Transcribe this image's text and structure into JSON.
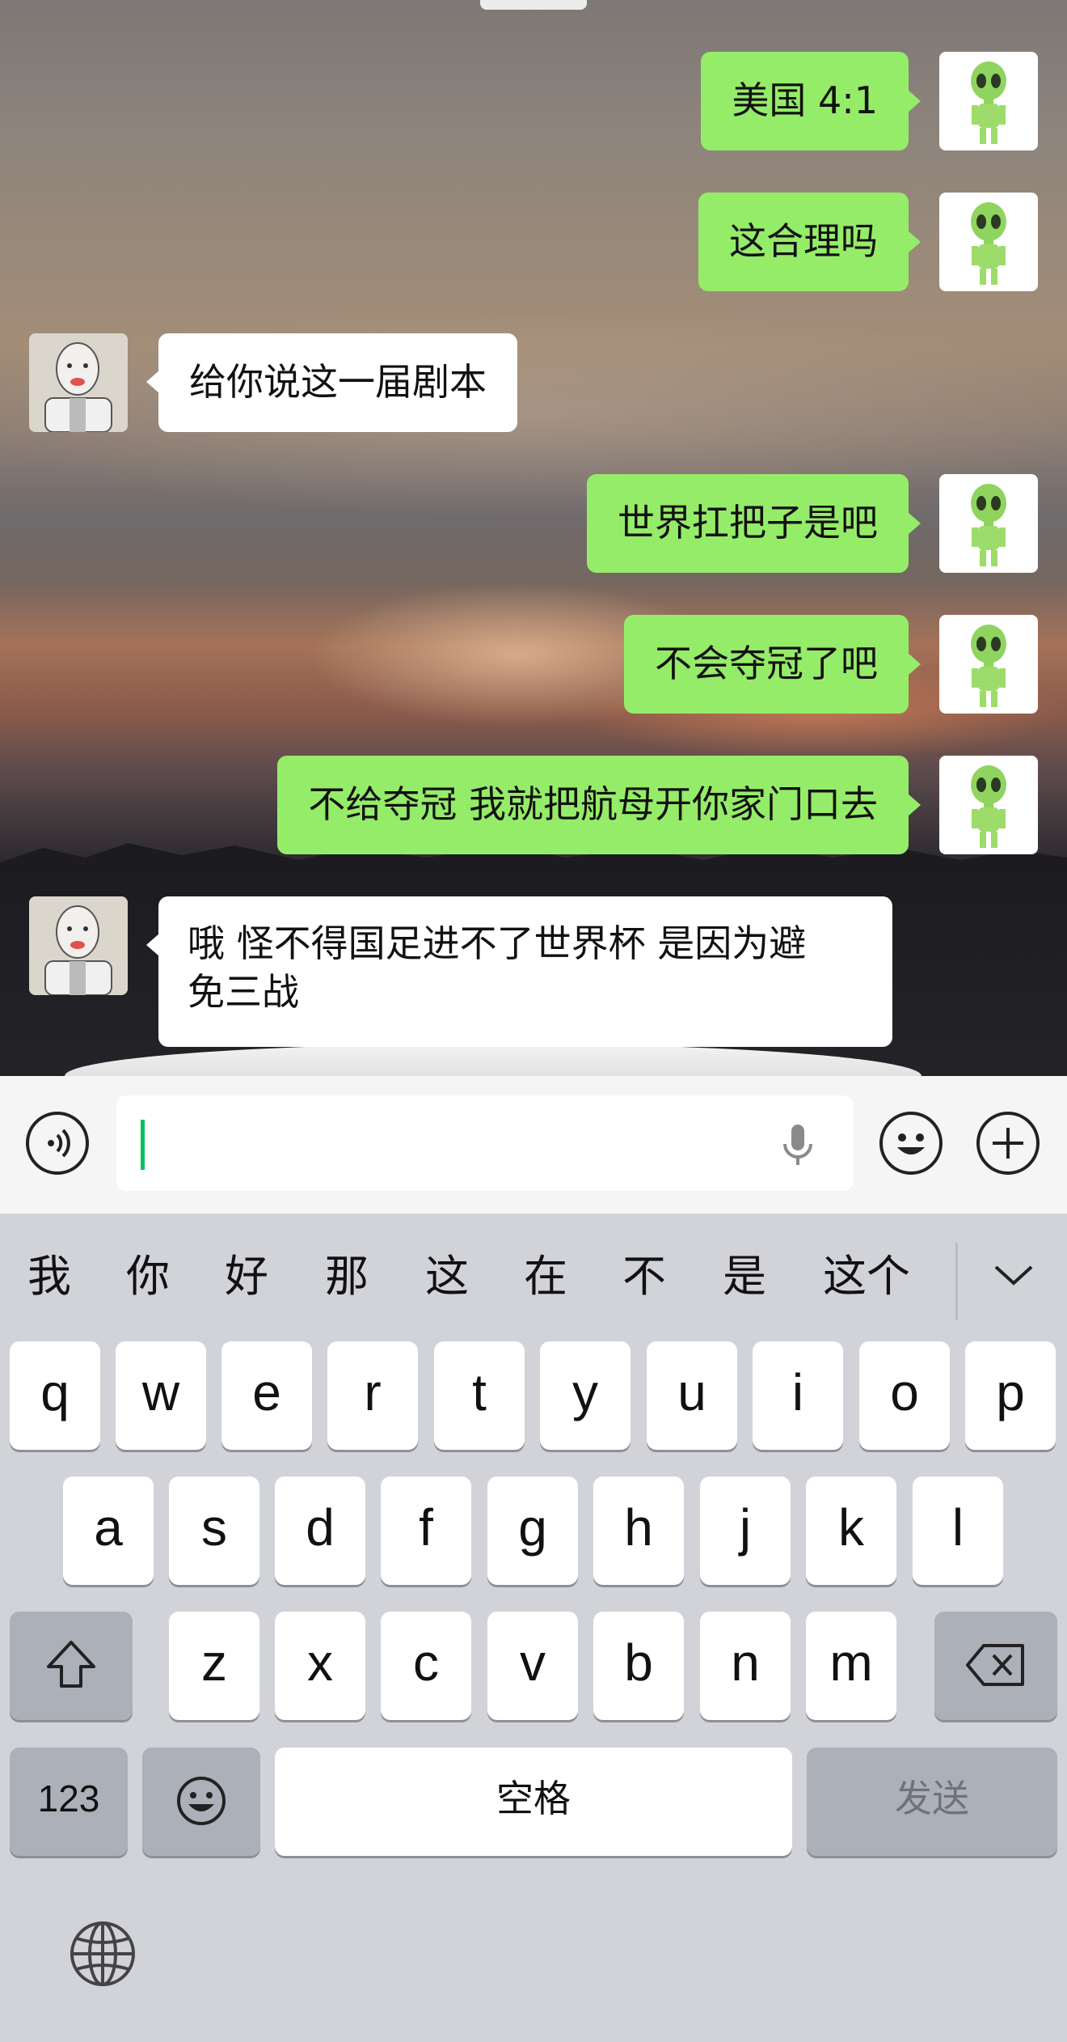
{
  "messages": [
    {
      "side": "right",
      "text": "美国 4:1"
    },
    {
      "side": "right",
      "text": "这合理吗"
    },
    {
      "side": "left",
      "text": "给你说这一届剧本"
    },
    {
      "side": "right",
      "text": "世界扛把子是吧"
    },
    {
      "side": "right",
      "text": "不会夺冠了吧"
    },
    {
      "side": "right",
      "text": "不给夺冠 我就把航母开你家门口去"
    },
    {
      "side": "left",
      "lines": [
        "哦 怪不得国足进不了世界杯 是因为避",
        "免三战"
      ]
    }
  ],
  "avatars": {
    "self": "alien-avatar",
    "other": "robot-avatar"
  },
  "input": {
    "value": "",
    "voice_icon": "voice-icon",
    "mic_icon": "microphone-icon",
    "emoji_icon": "emoji-icon",
    "plus_icon": "plus-icon"
  },
  "keyboard": {
    "candidates": [
      "我",
      "你",
      "好",
      "那",
      "这",
      "在",
      "不",
      "是",
      "这个"
    ],
    "row1": [
      "q",
      "w",
      "e",
      "r",
      "t",
      "y",
      "u",
      "i",
      "o",
      "p"
    ],
    "row2": [
      "a",
      "s",
      "d",
      "f",
      "g",
      "h",
      "j",
      "k",
      "l"
    ],
    "row3": [
      "z",
      "x",
      "c",
      "v",
      "b",
      "n",
      "m"
    ],
    "numbers_label": "123",
    "space_label": "空格",
    "send_label": "发送"
  },
  "colors": {
    "self_bubble": "#95ec69",
    "other_bubble": "#ffffff",
    "caret": "#07c160",
    "key_bg": "#ffffff",
    "keyboard_bg": "#d1d3d9"
  }
}
